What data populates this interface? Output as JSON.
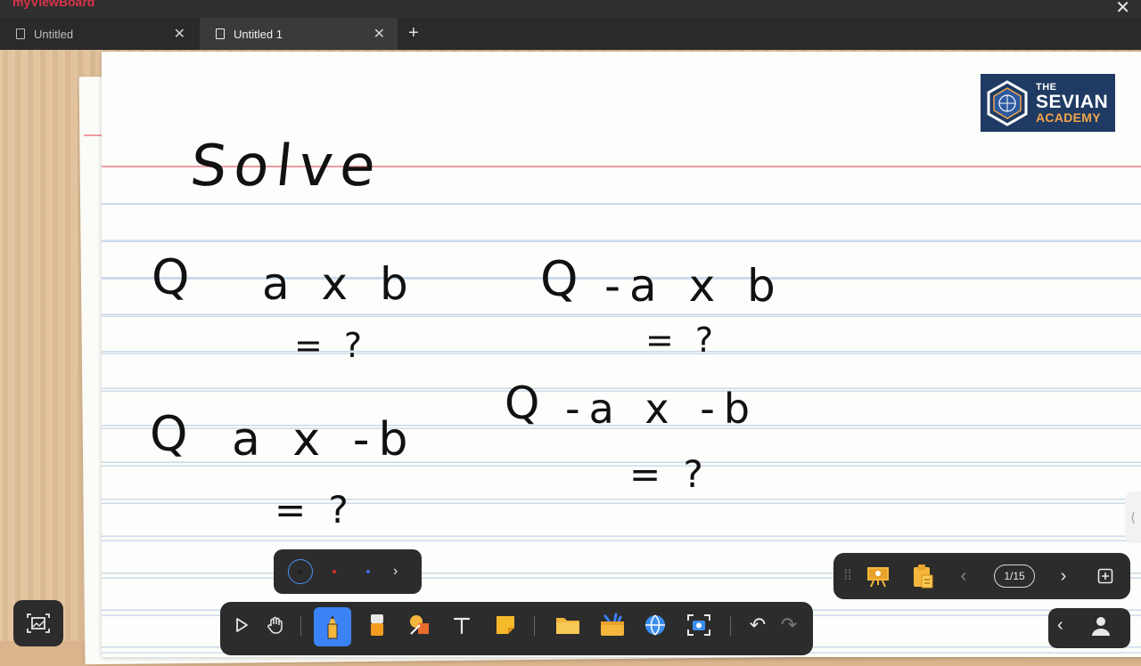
{
  "app": {
    "brand": "myViewBoard",
    "close_glyph": "✕"
  },
  "tabs": [
    {
      "label": "Untitled",
      "active": false
    },
    {
      "label": "Untitled 1",
      "active": true
    }
  ],
  "tab_close_glyph": "✕",
  "new_tab_glyph": "+",
  "logo": {
    "line1": "THE",
    "line2": "SEVIAN",
    "line3": "ACADEMY",
    "bg": "#1f3a63",
    "accent": "#f2a64a"
  },
  "board": {
    "title": "Solve",
    "problems": [
      {
        "marker": "Q",
        "expression": "a x b",
        "answer": "= ?"
      },
      {
        "marker": "Q",
        "expression": "-a x b",
        "answer": "= ?"
      },
      {
        "marker": "Q",
        "expression": "a x -b",
        "answer": "= ?"
      },
      {
        "marker": "Q",
        "expression": "-a x -b",
        "answer": "= ?"
      }
    ]
  },
  "palette": {
    "swatches": [
      {
        "name": "black",
        "color": "#1a1a1a",
        "selected": true
      },
      {
        "name": "red",
        "color": "#d93025",
        "selected": false
      },
      {
        "name": "blue",
        "color": "#3b6fe0",
        "selected": false
      }
    ],
    "more_glyph": "›"
  },
  "toolbar": {
    "tools": [
      "select-icon",
      "hand-icon",
      "pen-icon",
      "eraser-icon",
      "shapes-icon",
      "text-icon",
      "sticky-note-icon",
      "folder-icon",
      "toolbox-icon",
      "browser-icon",
      "screenshot-icon",
      "undo-icon",
      "redo-icon"
    ],
    "active_tool": "pen-icon",
    "undo_glyph": "↶",
    "redo_glyph": "↷"
  },
  "page_nav": {
    "current_page": "1/15",
    "prev_glyph": "‹",
    "next_glyph": "›",
    "add_glyph": "+"
  },
  "bottom_right": {
    "collapse_glyph": "‹"
  },
  "side_handle_glyph": "⟨"
}
